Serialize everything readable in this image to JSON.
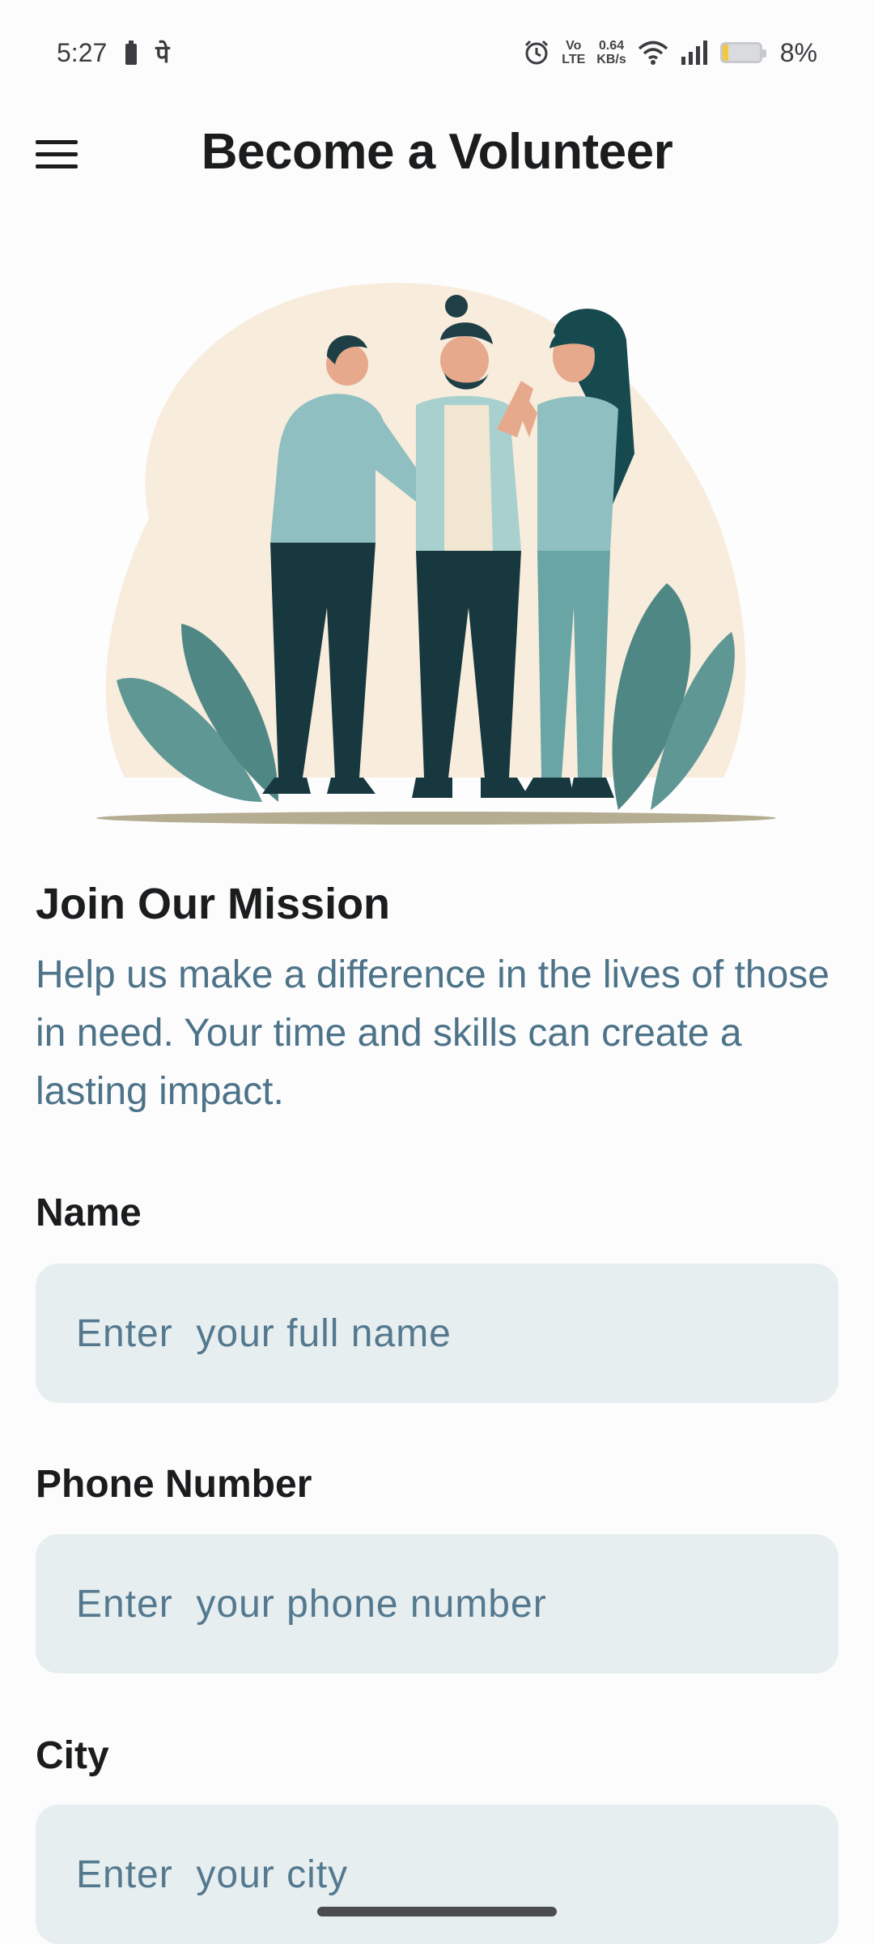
{
  "status": {
    "time": "5:27",
    "carrier_glyph": "पे",
    "volte_top": "Vo",
    "volte_bottom": "LTE",
    "speed_value": "0.64",
    "speed_unit": "KB/s",
    "battery": "8%",
    "battery_level": 0.08
  },
  "header": {
    "title": "Become a Volunteer"
  },
  "mission": {
    "heading": "Join Our Mission",
    "body": "Help us make a difference in the lives of those in need. Your time and skills can create a lasting impact."
  },
  "form": {
    "name": {
      "label": "Name",
      "placeholder": "Enter  your full name"
    },
    "phone": {
      "label": "Phone Number",
      "placeholder": "Enter  your phone number"
    },
    "city": {
      "label": "City",
      "placeholder": "Enter  your city"
    }
  },
  "colors": {
    "accent_text": "#4d7389",
    "field_bg": "#e7eef0",
    "illustration_dark": "#1e4d52",
    "illustration_light": "#8fbfc0",
    "blob": "#f8ecdc"
  },
  "icons": [
    "menu-icon",
    "battery-icon",
    "alarm-icon",
    "wifi-icon",
    "signal-icon"
  ]
}
